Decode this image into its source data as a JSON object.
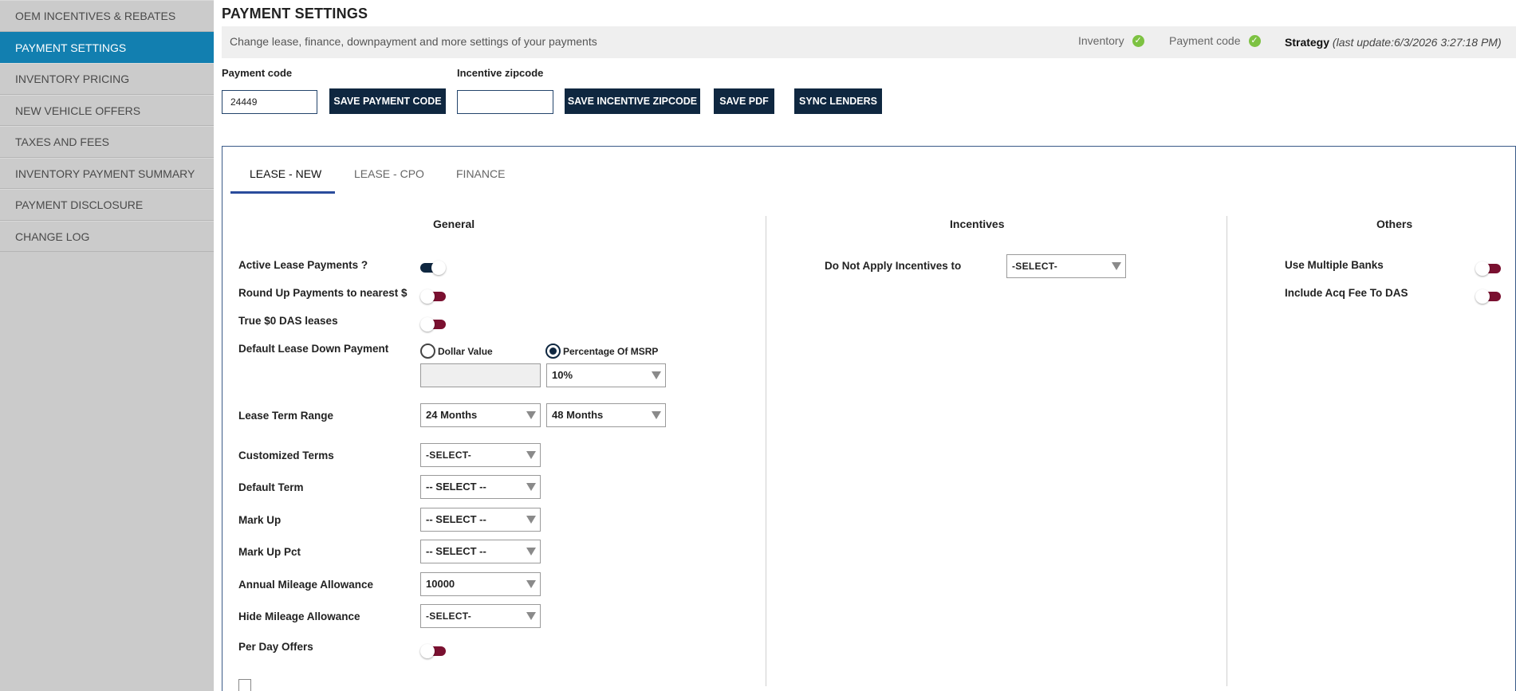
{
  "sidebar": {
    "items": [
      {
        "label": "OEM INCENTIVES & REBATES"
      },
      {
        "label": "PAYMENT SETTINGS"
      },
      {
        "label": "INVENTORY PRICING"
      },
      {
        "label": "NEW VEHICLE OFFERS"
      },
      {
        "label": "TAXES AND FEES"
      },
      {
        "label": "INVENTORY PAYMENT SUMMARY"
      },
      {
        "label": "PAYMENT DISCLOSURE"
      },
      {
        "label": "CHANGE LOG"
      }
    ],
    "active_index": 1
  },
  "header": {
    "title": "PAYMENT SETTINGS",
    "info_text": "Change lease, finance, downpayment and more settings of your payments",
    "status_inventory": "Inventory",
    "status_payment_code": "Payment code",
    "check_glyph": "✓",
    "strategy_label": "Strategy",
    "strategy_update": "(last update:6/3/2026 3:27:18 PM)"
  },
  "form": {
    "payment_code_label": "Payment code",
    "payment_code_value": "24449",
    "incentive_zip_label": "Incentive zipcode",
    "incentive_zip_value": "",
    "save_payment_code": "SAVE PAYMENT CODE",
    "save_incentive_zip": "SAVE INCENTIVE ZIPCODE",
    "save_pdf": "SAVE PDF",
    "sync_lenders": "SYNC LENDERS"
  },
  "tabs": [
    {
      "label": "LEASE - NEW",
      "active": true
    },
    {
      "label": "LEASE - CPO",
      "active": false
    },
    {
      "label": "FINANCE",
      "active": false
    }
  ],
  "columns": {
    "general": "General",
    "incentives": "Incentives",
    "others": "Others"
  },
  "general": {
    "active_lease_payments": {
      "label": "Active Lease Payments ?",
      "on": true
    },
    "round_up_payments": {
      "label": "Round Up Payments to nearest $",
      "on": false
    },
    "true_zero_das": {
      "label": "True $0 DAS leases",
      "on": false
    },
    "default_lease_down_payment": {
      "label": "Default Lease Down Payment",
      "option_dollar": "Dollar Value",
      "option_percentage": "Percentage Of MSRP",
      "selected": "Percentage Of MSRP",
      "dollar_value": "",
      "percentage_value": "10%"
    },
    "lease_term_range": {
      "label": "Lease Term Range",
      "from": "24 Months",
      "to": "48 Months"
    },
    "customized_terms": {
      "label": "Customized Terms",
      "value": "-SELECT-"
    },
    "default_term": {
      "label": "Default Term",
      "value": "-- SELECT --"
    },
    "mark_up": {
      "label": "Mark Up",
      "value": "-- SELECT --"
    },
    "mark_up_pct": {
      "label": "Mark Up Pct",
      "value": "-- SELECT --"
    },
    "annual_mileage": {
      "label": "Annual Mileage Allowance",
      "value": "10000"
    },
    "hide_mileage": {
      "label": "Hide Mileage Allowance",
      "value": "-SELECT-"
    },
    "per_day_offers": {
      "label": "Per Day Offers",
      "on": false
    }
  },
  "incentives": {
    "do_not_apply": {
      "label": "Do Not Apply Incentives to",
      "value": "-SELECT-"
    }
  },
  "others": {
    "use_multiple_banks": {
      "label": "Use Multiple Banks",
      "on": false
    },
    "include_acq_fee": {
      "label": "Include Acq Fee To DAS",
      "on": false
    }
  },
  "colors": {
    "sidebar_active": "#127fb0",
    "button_bg": "#0f2740",
    "toggle_off": "#7a1030",
    "check_green": "#7dc242"
  }
}
